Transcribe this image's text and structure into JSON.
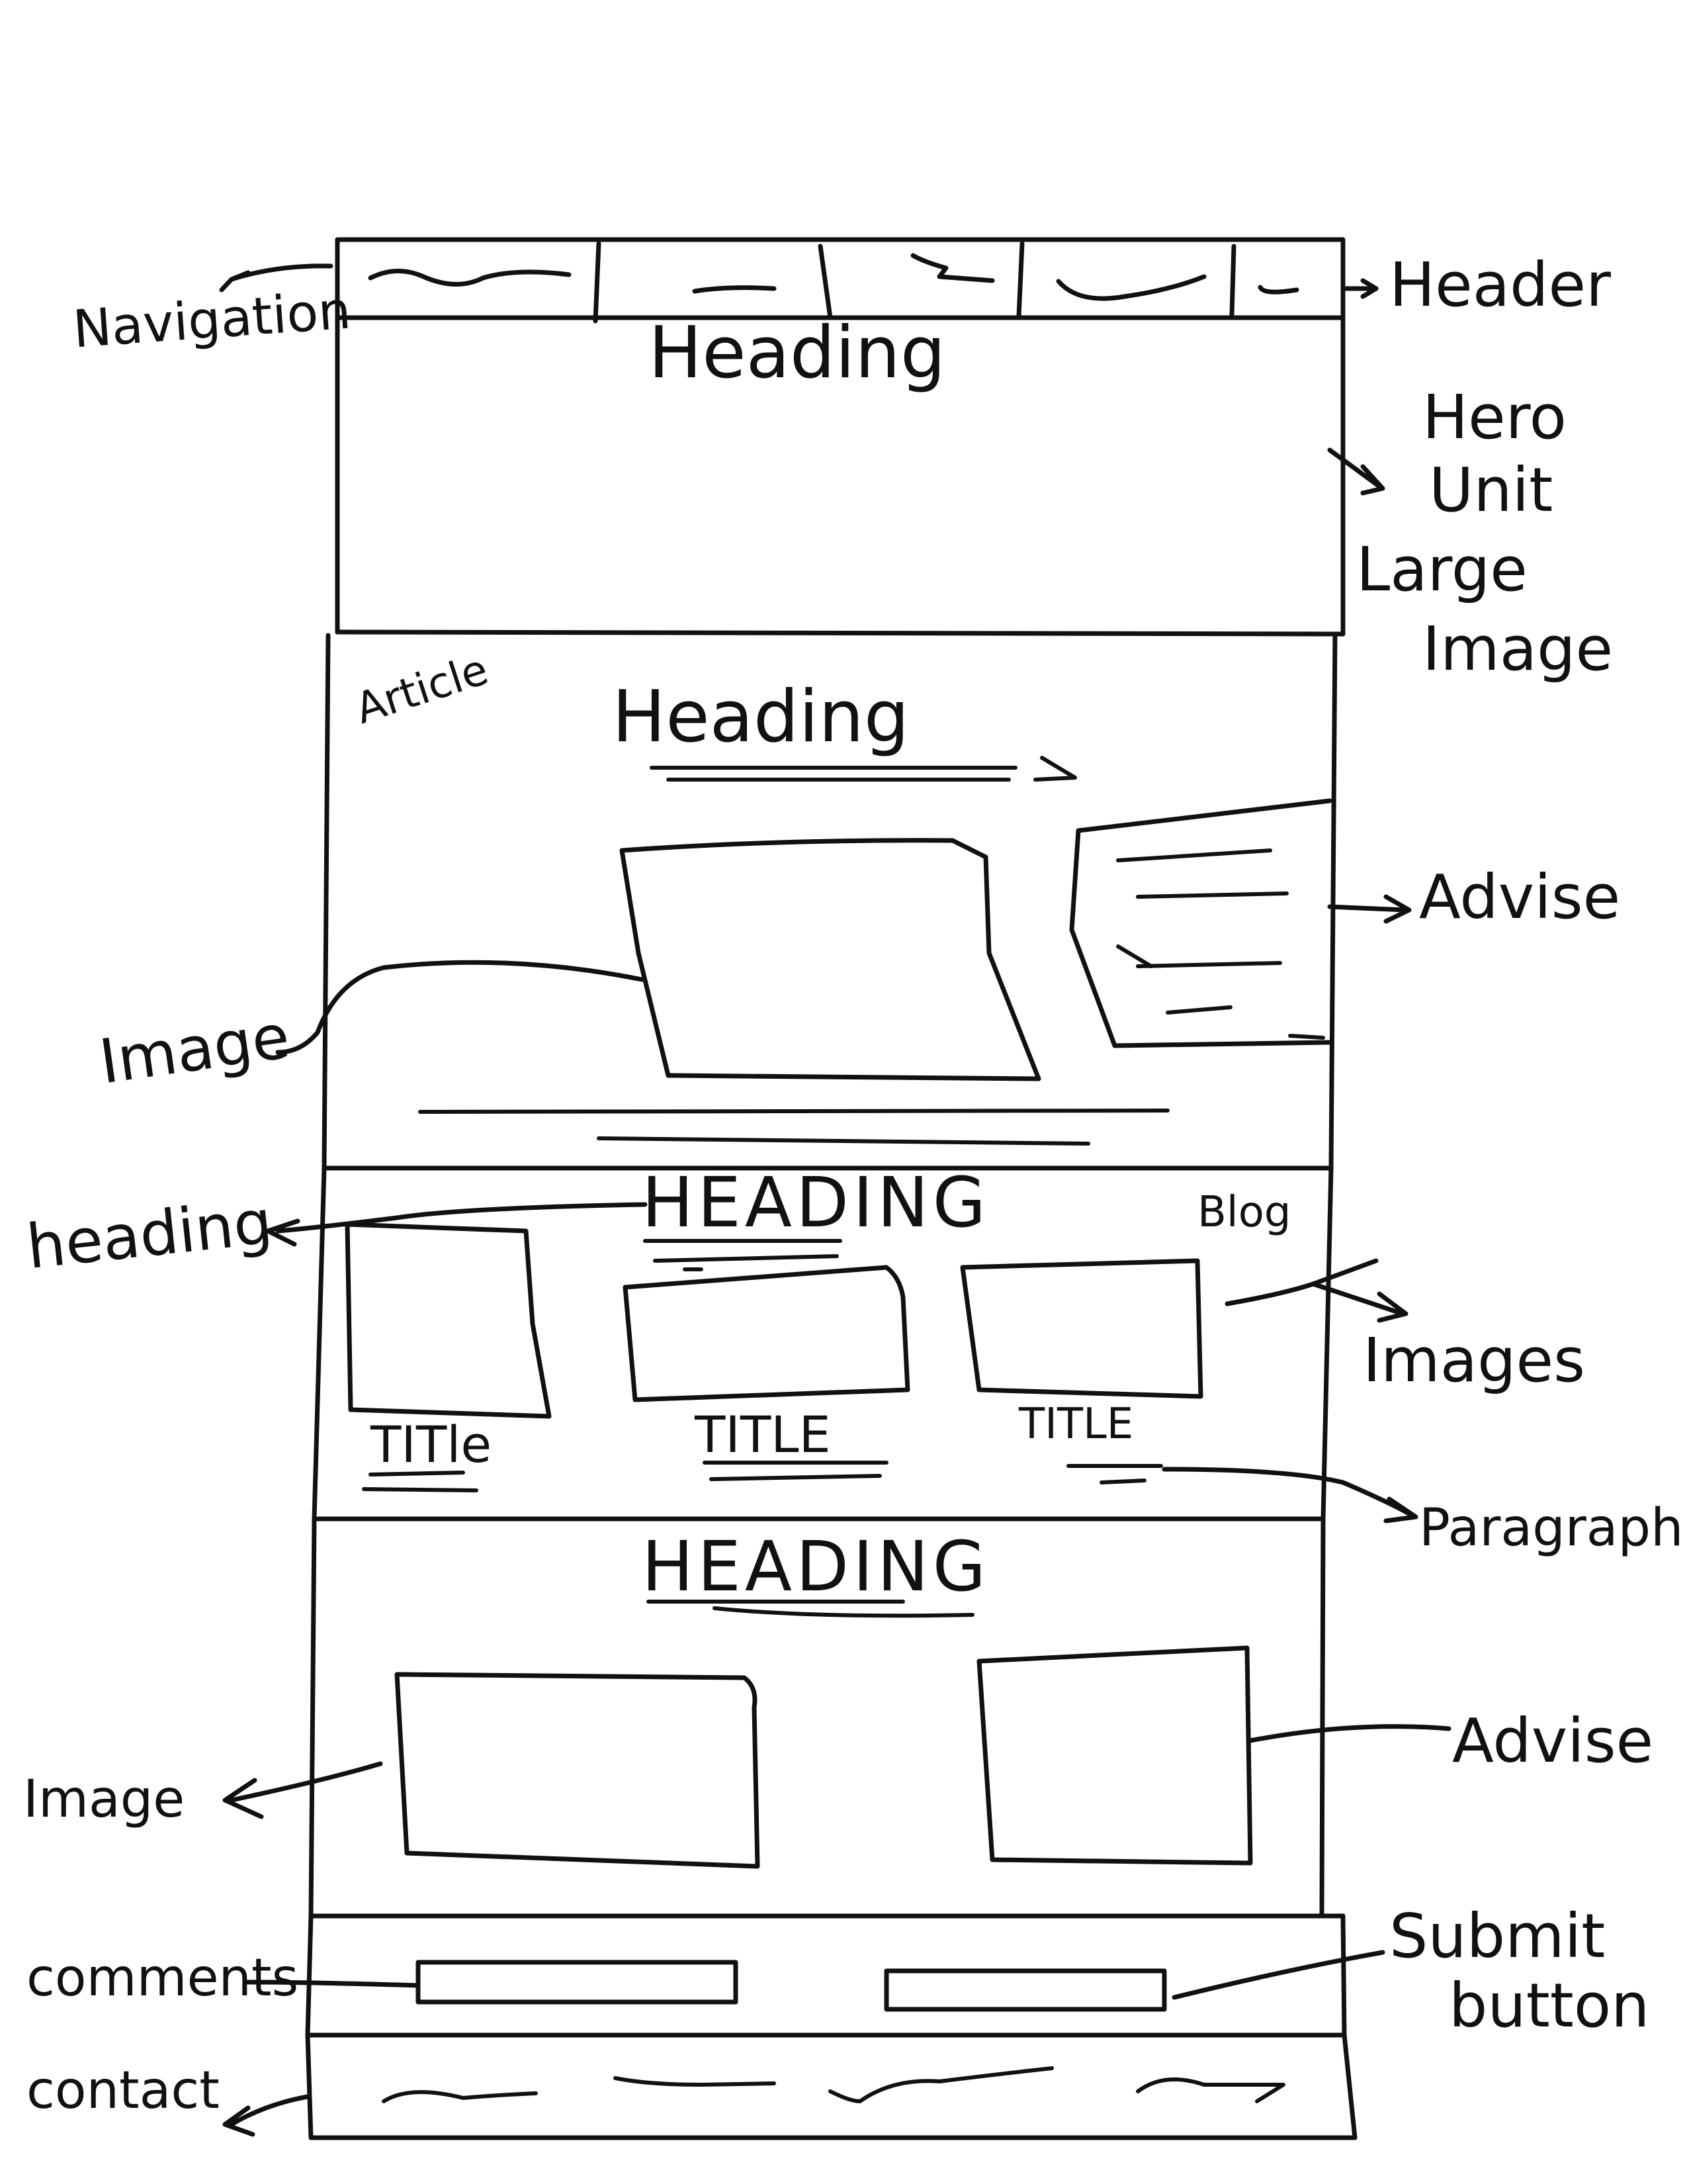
{
  "annotations": {
    "navigation": "Navigation",
    "header": "Header",
    "hero_line1": "Hero",
    "hero_line2": "Unit",
    "hero_line3": "Large",
    "hero_line4": "Image",
    "article": "Article",
    "advise_1": "Advise",
    "image_1": "Image",
    "heading_left": "heading",
    "blog": "Blog",
    "images": "Images",
    "paragraph": "Paragraph",
    "advise_2": "Advise",
    "image_2": "Image",
    "comments": "comments",
    "submit_line1": "Submit",
    "submit_line2": "button",
    "contact": "contact"
  },
  "hero": {
    "heading": "Heading"
  },
  "article": {
    "heading": "Heading"
  },
  "blog": {
    "heading": "HEADING",
    "titles": [
      "TITle",
      "TITLE",
      "TITLE"
    ]
  },
  "advise_section": {
    "heading": "HEADING"
  }
}
